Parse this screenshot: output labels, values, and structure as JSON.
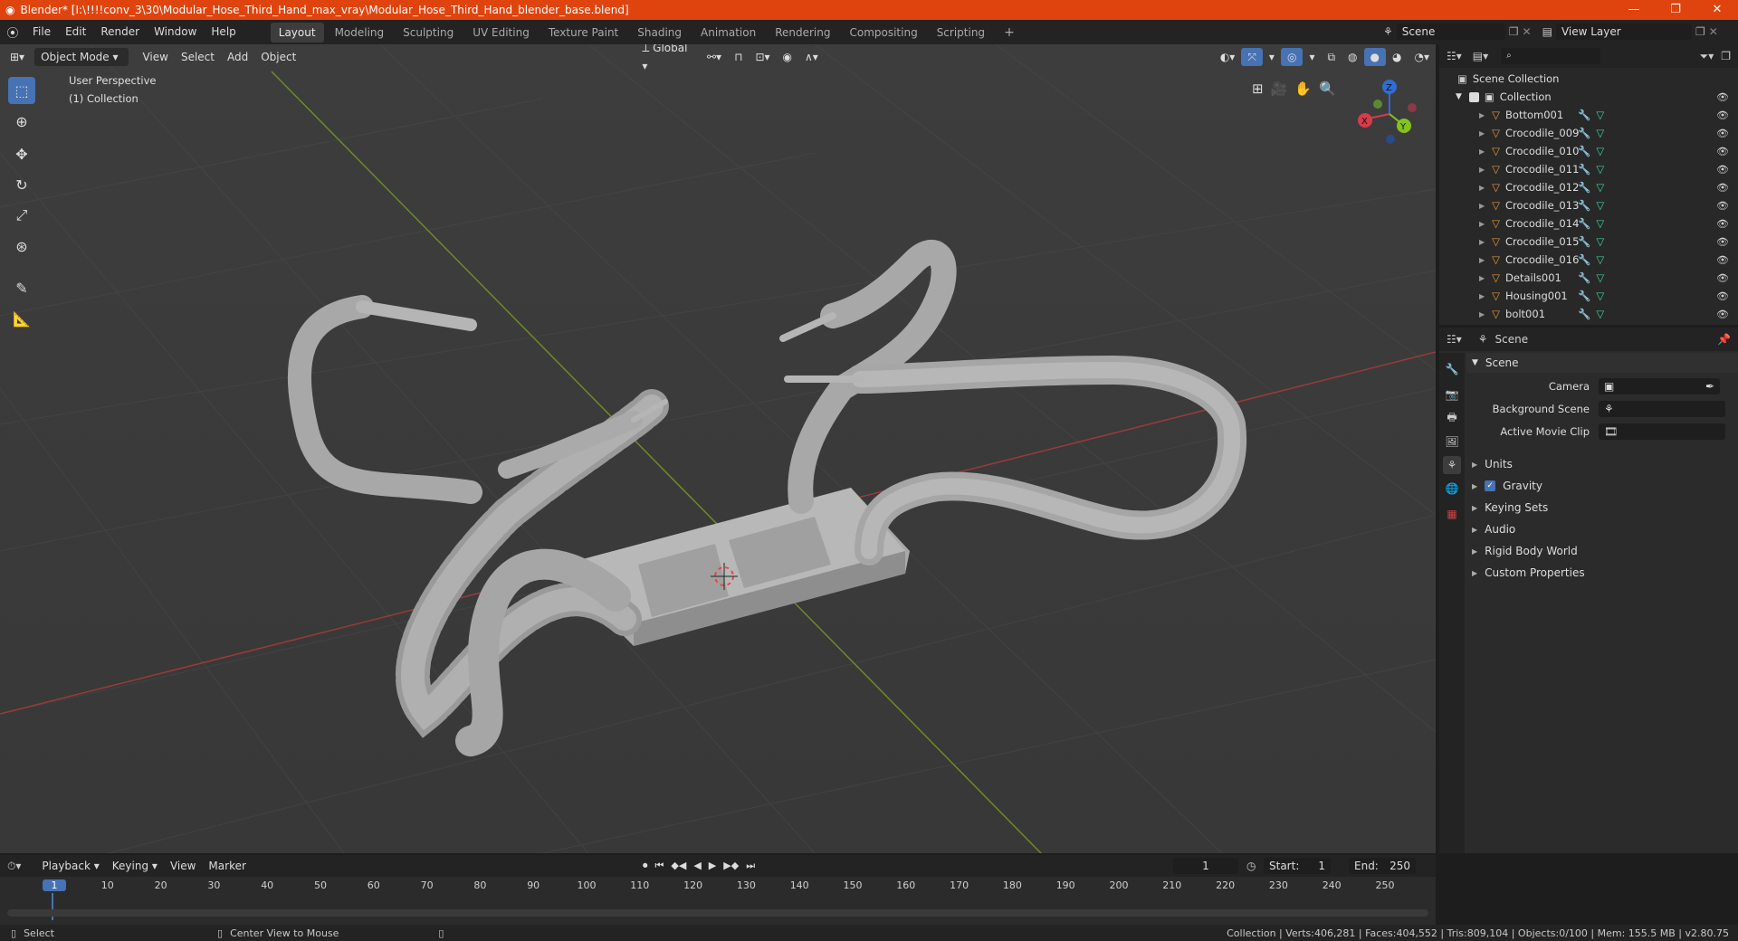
{
  "titlebar": {
    "title": "Blender* [I:\\!!!!conv_3\\30\\Modular_Hose_Third_Hand_max_vray\\Modular_Hose_Third_Hand_blender_base.blend]",
    "minimize": "—",
    "maximize": "❐",
    "close": "✕"
  },
  "menus": [
    "File",
    "Edit",
    "Render",
    "Window",
    "Help"
  ],
  "workspaces": [
    "Layout",
    "Modeling",
    "Sculpting",
    "UV Editing",
    "Texture Paint",
    "Shading",
    "Animation",
    "Rendering",
    "Compositing",
    "Scripting"
  ],
  "active_workspace": "Layout",
  "scene_field": "Scene",
  "view_layer_field": "View Layer",
  "viewport": {
    "mode": "Object Mode",
    "menus": [
      "View",
      "Select",
      "Add",
      "Object"
    ],
    "transform": "Global",
    "perspective_label": "User Perspective",
    "collection_label": "(1) Collection",
    "gizmo": {
      "x": "X",
      "y": "Y",
      "z": "Z"
    }
  },
  "outliner": {
    "root": "Scene Collection",
    "collection": "Collection",
    "items": [
      "Bottom001",
      "Crocodile_009",
      "Crocodile_010",
      "Crocodile_011",
      "Crocodile_012",
      "Crocodile_013",
      "Crocodile_014",
      "Crocodile_015",
      "Crocodile_016",
      "Details001",
      "Housing001",
      "bolt001"
    ]
  },
  "properties": {
    "header": "Scene",
    "panel": "Scene",
    "camera_label": "Camera",
    "background_scene_label": "Background Scene",
    "active_movie_clip_label": "Active Movie Clip",
    "sections": [
      "Units",
      "Gravity",
      "Keying Sets",
      "Audio",
      "Rigid Body World",
      "Custom Properties"
    ]
  },
  "timeline": {
    "menus": [
      "Playback",
      "Keying",
      "View",
      "Marker"
    ],
    "current_frame": "1",
    "start_label": "Start:",
    "start": "1",
    "end_label": "End:",
    "end": "250",
    "ticks": [
      "1",
      "10",
      "20",
      "30",
      "40",
      "50",
      "60",
      "70",
      "80",
      "90",
      "100",
      "110",
      "120",
      "130",
      "140",
      "150",
      "160",
      "170",
      "180",
      "190",
      "200",
      "210",
      "220",
      "230",
      "240",
      "250"
    ]
  },
  "status": {
    "select": "Select",
    "center_view": "Center View to Mouse",
    "stats": "Collection | Verts:406,281 | Faces:404,552 | Tris:809,104 | Objects:0/100 | Mem: 155.5 MB | v2.80.75"
  },
  "colors": {
    "title_bar": "#e0440e",
    "accent": "#4772b3",
    "mesh_icon": "#e6953b",
    "modifier_icon": "#5b9bd5",
    "data_icon": "#3fcf9f"
  }
}
